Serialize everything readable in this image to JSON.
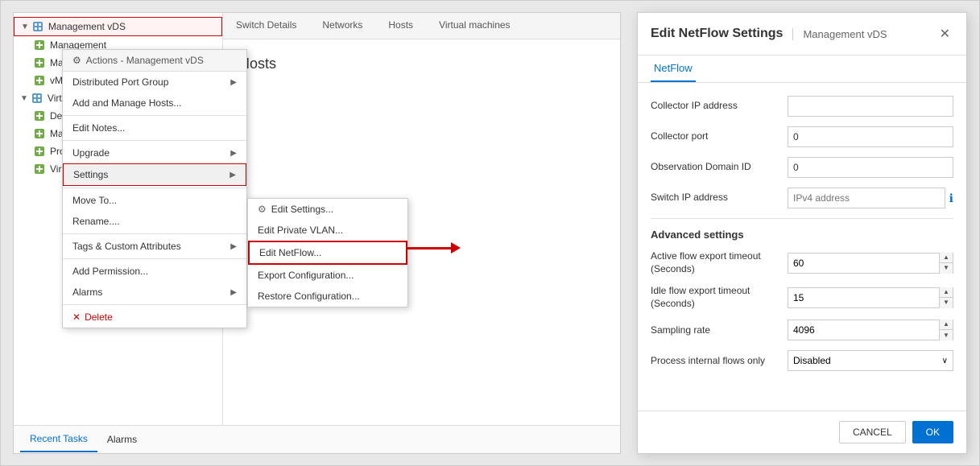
{
  "leftPanel": {
    "tree": {
      "items": [
        {
          "id": "mgmt-vds",
          "label": "Management vDS",
          "level": 0,
          "selected": true,
          "hasChevron": true,
          "expanded": true
        },
        {
          "id": "management",
          "label": "Management",
          "level": 1
        },
        {
          "id": "mgmt-vds-dv",
          "label": "Management vDS-DV...",
          "level": 1
        },
        {
          "id": "vmotion",
          "label": "vMotion",
          "level": 1
        },
        {
          "id": "vm-vds",
          "label": "Virtual Machine vDS",
          "level": 0,
          "hasChevron": true,
          "expanded": true
        },
        {
          "id": "dev-vms",
          "label": "Devolepment VMs",
          "level": 1
        },
        {
          "id": "marketing-vms",
          "label": "Marketing VMs",
          "level": 1
        },
        {
          "id": "production-vms",
          "label": "Production VMs",
          "level": 1
        },
        {
          "id": "vm-dvu",
          "label": "Virtual Machine -DVU...",
          "level": 1
        }
      ]
    },
    "tabs": [
      "Switch Details",
      "Networks",
      "Hosts",
      "Virtual machines"
    ],
    "hostsTitle": "Hosts",
    "bottomTabs": [
      "Recent Tasks",
      "Alarms"
    ],
    "activeBottomTab": "Recent Tasks"
  },
  "contextMenu": {
    "header": "Actions - Management vDS",
    "items": [
      {
        "id": "dist-port-group",
        "label": "Distributed Port Group",
        "hasArrow": true
      },
      {
        "id": "add-manage-hosts",
        "label": "Add and Manage Hosts..."
      },
      {
        "id": "edit-notes",
        "label": "Edit Notes..."
      },
      {
        "id": "upgrade",
        "label": "Upgrade",
        "hasArrow": true
      },
      {
        "id": "settings",
        "label": "Settings",
        "hasArrow": true,
        "highlighted": true
      },
      {
        "id": "move-to",
        "label": "Move To..."
      },
      {
        "id": "rename",
        "label": "Rename...."
      },
      {
        "id": "tags",
        "label": "Tags & Custom Attributes",
        "hasArrow": true
      },
      {
        "id": "add-permission",
        "label": "Add Permission..."
      },
      {
        "id": "alarms",
        "label": "Alarms",
        "hasArrow": true
      },
      {
        "id": "delete",
        "label": "Delete",
        "isDelete": true
      }
    ]
  },
  "submenu": {
    "items": [
      {
        "id": "edit-settings",
        "label": "Edit Settings...",
        "hasIcon": true
      },
      {
        "id": "edit-pvlan",
        "label": "Edit Private VLAN..."
      },
      {
        "id": "edit-netflow",
        "label": "Edit NetFlow...",
        "highlighted": true
      },
      {
        "id": "export-config",
        "label": "Export Configuration..."
      },
      {
        "id": "restore-config",
        "label": "Restore Configuration..."
      }
    ]
  },
  "dialog": {
    "title": "Edit NetFlow Settings",
    "subtitle": "Management vDS",
    "closeLabel": "✕",
    "tabs": [
      "NetFlow"
    ],
    "activeTab": "NetFlow",
    "sections": {
      "basic": {
        "fields": [
          {
            "id": "collector-ip",
            "label": "Collector IP address",
            "value": "",
            "type": "text",
            "placeholder": ""
          },
          {
            "id": "collector-port",
            "label": "Collector port",
            "value": "0",
            "type": "text"
          },
          {
            "id": "obs-domain-id",
            "label": "Observation Domain ID",
            "value": "0",
            "type": "text"
          },
          {
            "id": "switch-ip",
            "label": "Switch IP address",
            "value": "",
            "type": "text",
            "placeholder": "IPv4 address",
            "hasInfo": true
          }
        ]
      },
      "advanced": {
        "title": "Advanced settings",
        "fields": [
          {
            "id": "active-flow",
            "label": "Active flow export timeout\n(Seconds)",
            "value": "60",
            "type": "spinner"
          },
          {
            "id": "idle-flow",
            "label": "Idle flow export timeout\n(Seconds)",
            "value": "15",
            "type": "spinner"
          },
          {
            "id": "sampling-rate",
            "label": "Sampling rate",
            "value": "4096",
            "type": "spinner"
          },
          {
            "id": "process-internal",
            "label": "Process internal flows only",
            "value": "Disabled",
            "type": "select"
          }
        ]
      }
    },
    "footer": {
      "cancelLabel": "CANCEL",
      "okLabel": "OK"
    }
  }
}
